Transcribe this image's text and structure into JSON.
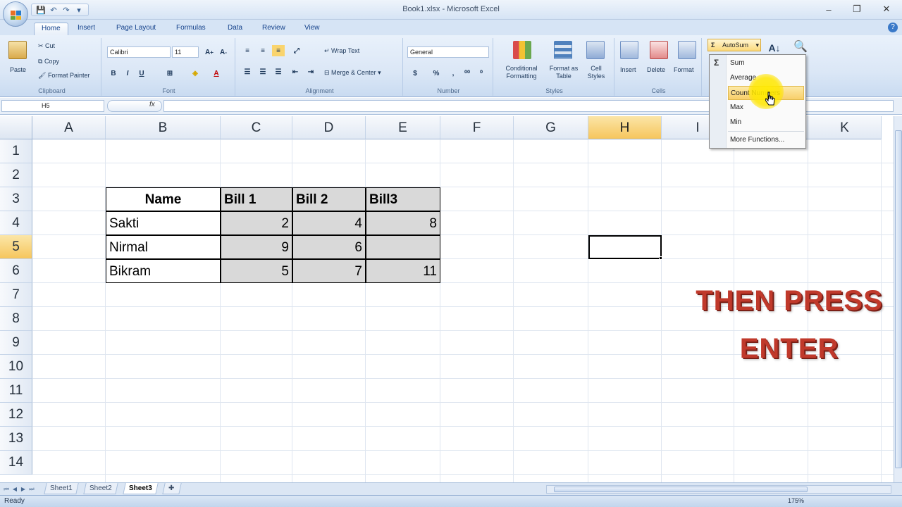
{
  "window": {
    "title": "Book1.xlsx - Microsoft Excel",
    "controls": [
      "minimize",
      "restore",
      "close"
    ]
  },
  "ribbon_tabs": [
    "Home",
    "Insert",
    "Page Layout",
    "Formulas",
    "Data",
    "Review",
    "View"
  ],
  "active_tab": "Home",
  "ribbon": {
    "clipboard": {
      "label": "Clipboard",
      "paste": "Paste",
      "cut": "Cut",
      "copy": "Copy",
      "format_painter": "Format Painter"
    },
    "font": {
      "label": "Font",
      "name": "Calibri",
      "size": "11",
      "bold": "B",
      "italic": "I",
      "underline": "U"
    },
    "alignment": {
      "label": "Alignment",
      "wrap_text": "Wrap Text",
      "merge_center": "Merge & Center"
    },
    "number": {
      "label": "Number",
      "format": "General",
      "currency": "$",
      "percent": "%",
      "comma": ","
    },
    "styles": {
      "label": "Styles",
      "conditional": "Conditional Formatting",
      "format_table": "Format as Table",
      "cell_styles": "Cell Styles"
    },
    "cells": {
      "label": "Cells",
      "insert": "Insert",
      "delete": "Delete",
      "format": "Format"
    },
    "editing": {
      "autosum": "AutoSum"
    }
  },
  "autosum_menu": {
    "items": [
      "Sum",
      "Average",
      "Count Numbers",
      "Max",
      "Min",
      "More Functions..."
    ],
    "highlighted": "Count Numbers"
  },
  "formula_bar": {
    "name_box": "H5",
    "fx": "fx",
    "formula": ""
  },
  "columns": [
    "A",
    "B",
    "C",
    "D",
    "E",
    "F",
    "G",
    "H",
    "I",
    "J",
    "K"
  ],
  "selected_column": "H",
  "rows": [
    "1",
    "2",
    "3",
    "4",
    "5",
    "6",
    "7",
    "8",
    "9",
    "10",
    "11",
    "12",
    "13",
    "14"
  ],
  "selected_row": "5",
  "table": {
    "headers": [
      "Name",
      "Bill 1",
      "Bill 2",
      "Bill3"
    ],
    "rows": [
      [
        "Sakti",
        "2",
        "4",
        "8"
      ],
      [
        "Nirmal",
        "9",
        "6",
        ""
      ],
      [
        "Bikram",
        "5",
        "7",
        "11"
      ]
    ]
  },
  "overlay": {
    "line1": "THEN PRESS",
    "line2": "ENTER",
    "color": "#c0392b"
  },
  "sheets": [
    "Sheet1",
    "Sheet2",
    "Sheet3"
  ],
  "active_sheet": "Sheet3",
  "status": {
    "text": "Ready",
    "zoom": "175%"
  }
}
